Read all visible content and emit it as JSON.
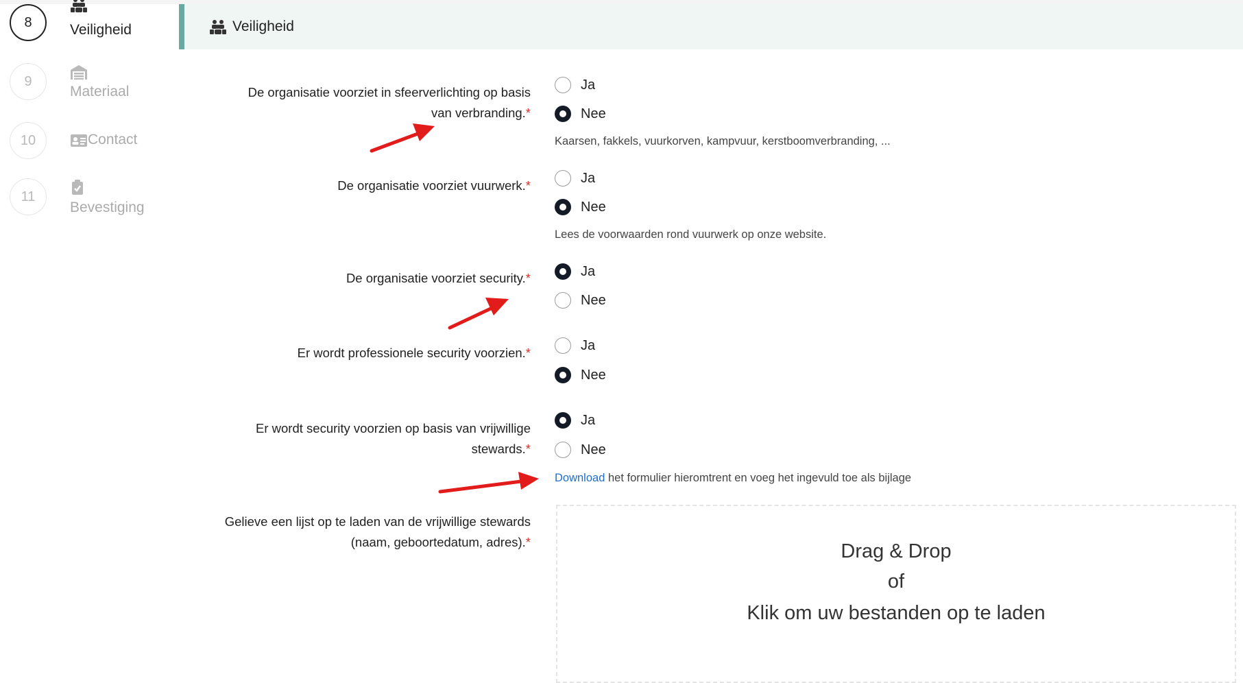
{
  "steps": [
    {
      "number": "8",
      "label": "Veiligheid",
      "icon": "people-group-icon",
      "state": "active"
    },
    {
      "number": "9",
      "label": "Materiaal",
      "icon": "warehouse-icon",
      "state": "inactive"
    },
    {
      "number": "10",
      "label": "Contact",
      "icon": "contact-card-icon",
      "state": "inactive"
    },
    {
      "number": "11",
      "label": "Bevestiging",
      "icon": "clipboard-check-icon",
      "state": "inactive"
    }
  ],
  "section": {
    "title": "Veiligheid",
    "icon": "people-group-icon",
    "accent_color": "#6aa9a0",
    "band_color": "#eff6f3"
  },
  "questions": [
    {
      "label_line1": "De organisatie voorziet in sfeerverlichting op basis",
      "label_line2": "van verbranding.",
      "options": [
        {
          "label": "Ja",
          "selected": false
        },
        {
          "label": "Nee",
          "selected": true
        }
      ],
      "hint": "Kaarsen, fakkels, vuurkorven, kampvuur, kerstboomverbranding, ..."
    },
    {
      "label_line1": "De organisatie voorziet vuurwerk.",
      "options": [
        {
          "label": "Ja",
          "selected": false
        },
        {
          "label": "Nee",
          "selected": true
        }
      ],
      "hint": "Lees de voorwaarden rond vuurwerk op onze website."
    },
    {
      "label_line1": "De organisatie voorziet security.",
      "options": [
        {
          "label": "Ja",
          "selected": true
        },
        {
          "label": "Nee",
          "selected": false
        }
      ]
    },
    {
      "label_line1": "Er wordt professionele security voorzien.",
      "options": [
        {
          "label": "Ja",
          "selected": false
        },
        {
          "label": "Nee",
          "selected": true
        }
      ]
    },
    {
      "label_line1": "Er wordt security voorzien op basis van vrijwillige",
      "label_line2": "stewards.",
      "options": [
        {
          "label": "Ja",
          "selected": true
        },
        {
          "label": "Nee",
          "selected": false
        }
      ],
      "hint_link": "Download",
      "hint_rest": " het formulier hieromtrent en voeg het ingevuld toe als bijlage"
    },
    {
      "label_line1": "Gelieve een lijst op te laden van de vrijwillige stewards",
      "label_line2": "(naam, geboortedatum, adres)."
    }
  ],
  "required_marker": "*",
  "dropzone": {
    "line1": "Drag & Drop",
    "line2": "of",
    "line3": "Klik om uw bestanden op te laden"
  },
  "colors": {
    "required": "#d9342b",
    "link": "#1f6fcb",
    "radio_selected": "#141a26",
    "annotation_arrow": "#e21b1b"
  }
}
